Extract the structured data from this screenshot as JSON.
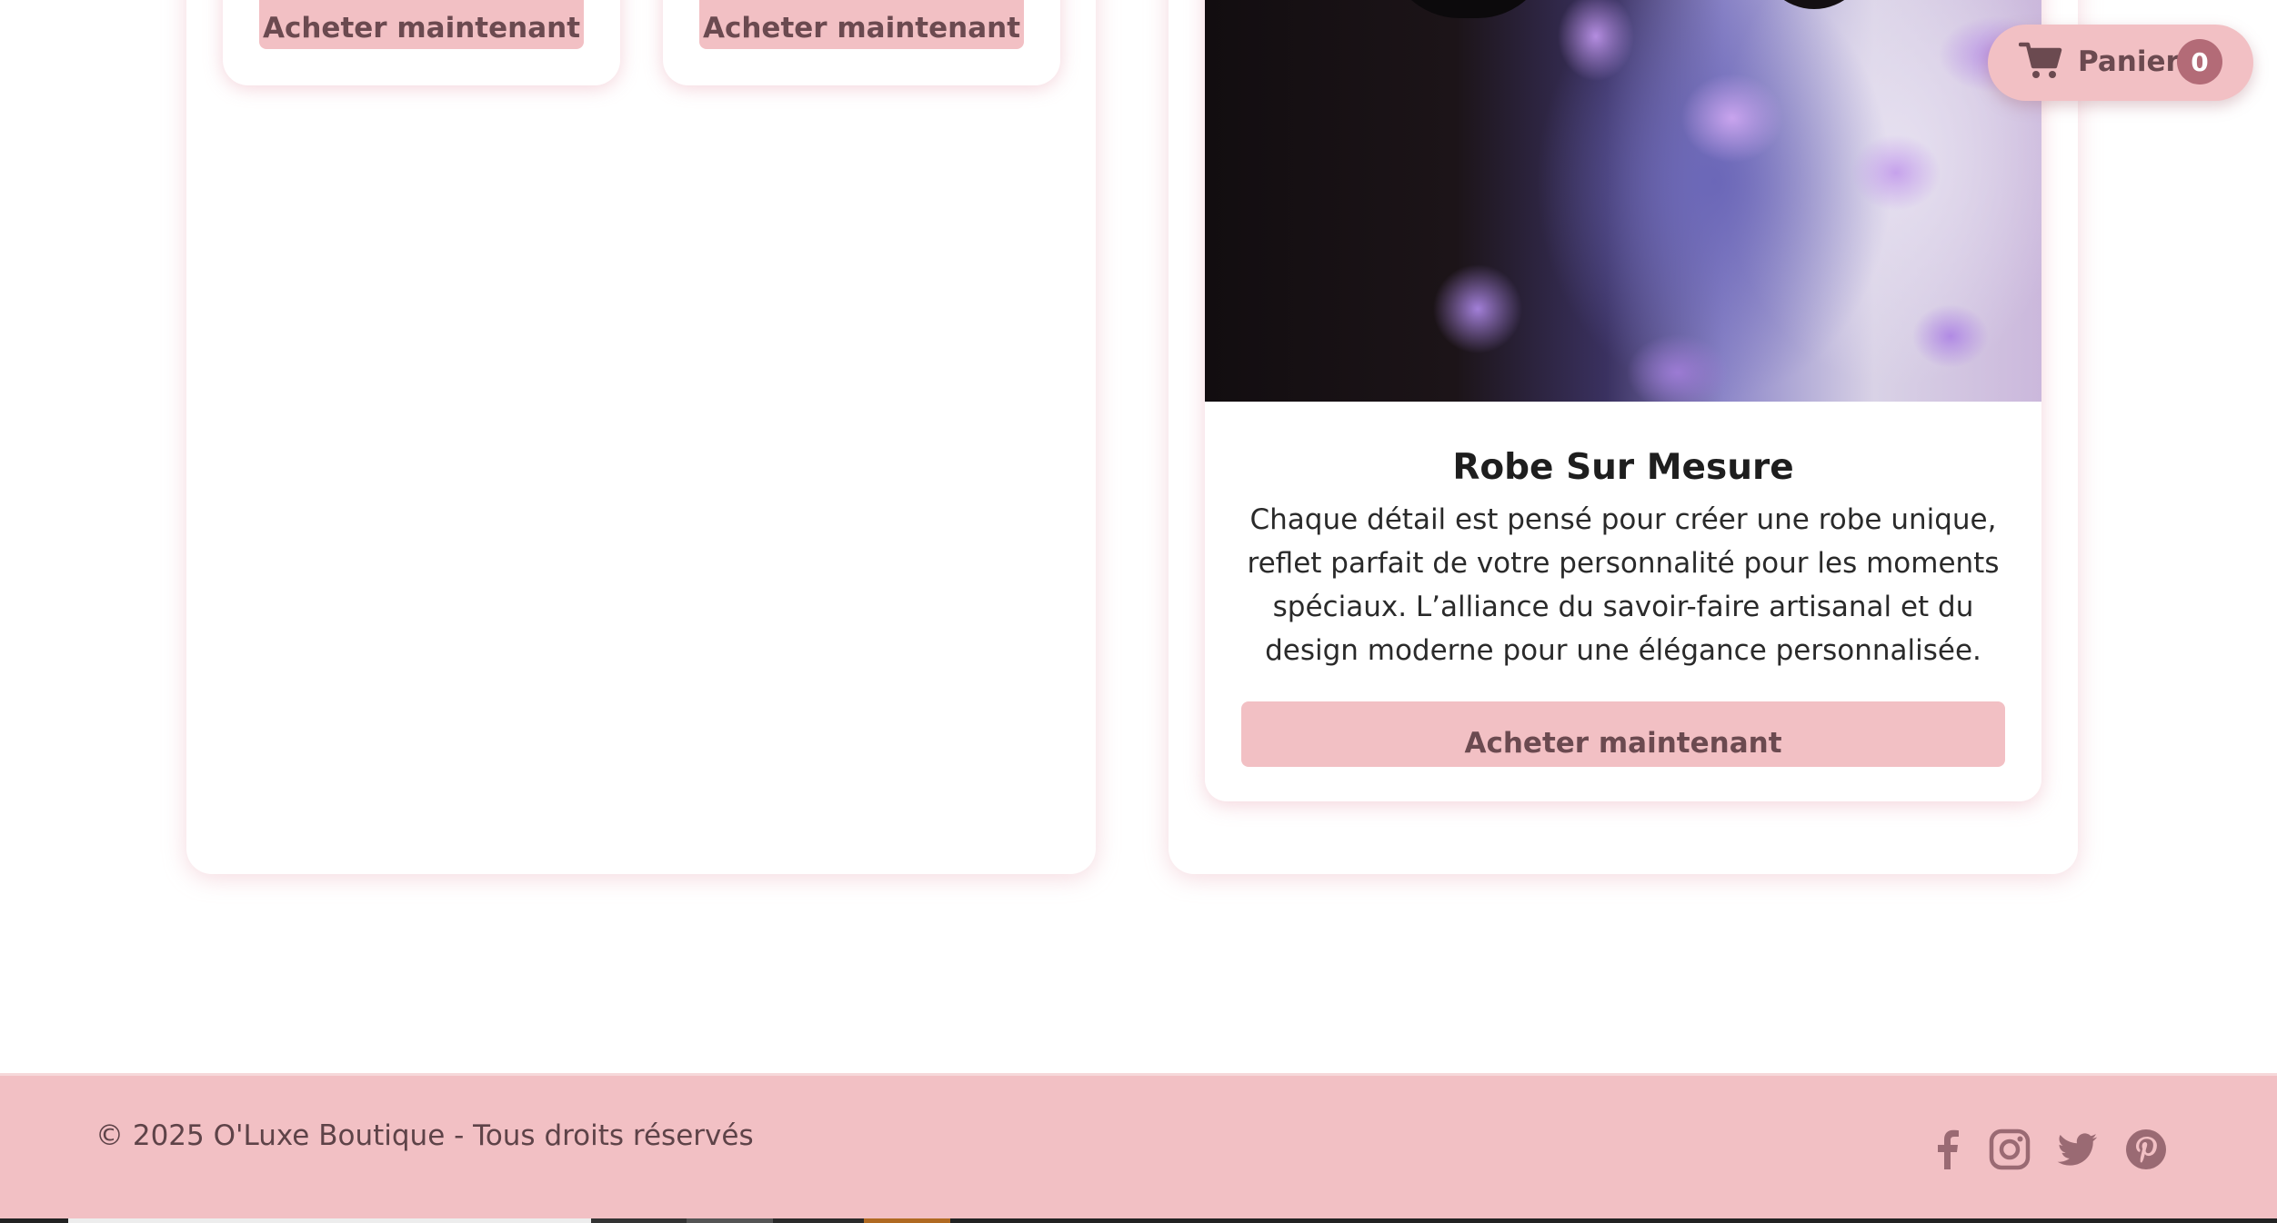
{
  "products": {
    "top_buttons": [
      {
        "label": "Acheter maintenant"
      },
      {
        "label": "Acheter maintenant"
      }
    ],
    "featured": {
      "title": "Robe Sur Mesure",
      "description": "Chaque détail est pensé pour créer une robe unique, reflet parfait de votre personnalité pour les moments spéciaux. L’alliance du savoir-faire artisanal et du design moderne pour une élégance personnalisée.",
      "button_label": "Acheter maintenant"
    }
  },
  "cart": {
    "label": "Panier",
    "count": "0",
    "icon": "shopping-cart-icon"
  },
  "footer": {
    "copyright": "© 2025 O'Luxe Boutique - Tous droits réservés",
    "social": [
      {
        "icon": "facebook-icon"
      },
      {
        "icon": "instagram-icon"
      },
      {
        "icon": "twitter-icon"
      },
      {
        "icon": "pinterest-icon"
      }
    ]
  },
  "colors": {
    "accent_pink": "#f2c0c4",
    "button_text": "#6b4a50",
    "badge": "#b36b77"
  }
}
